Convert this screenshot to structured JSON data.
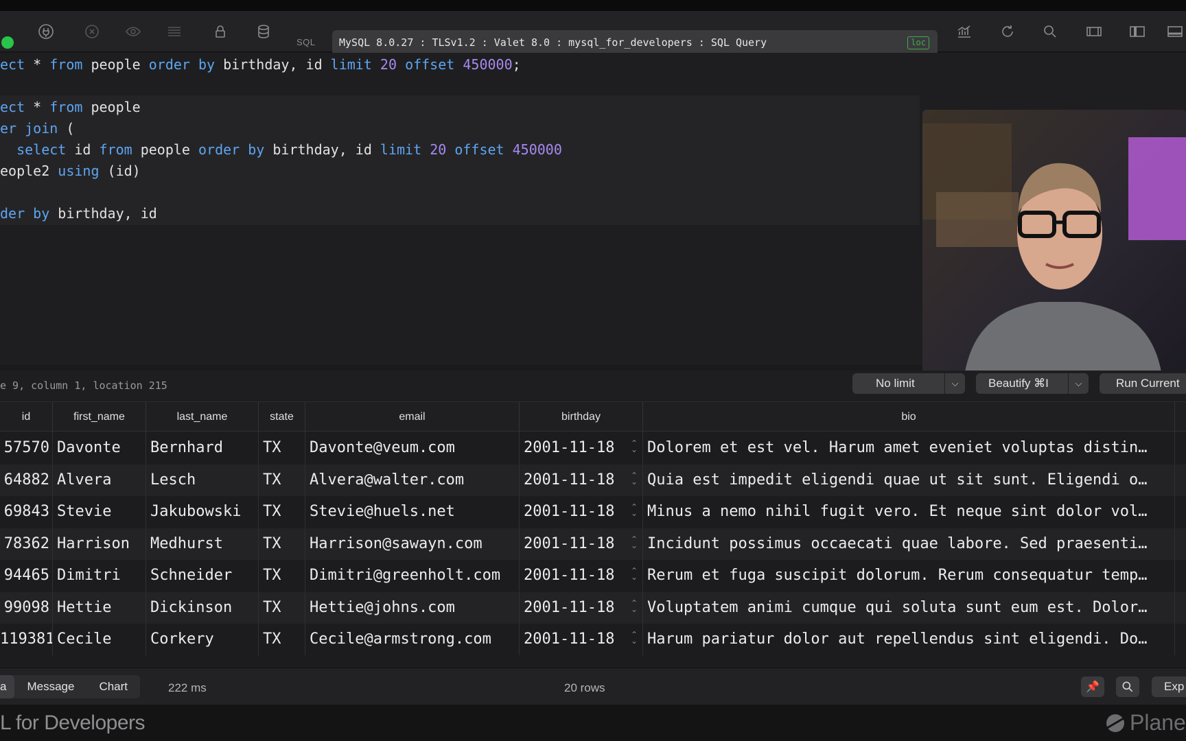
{
  "toolbar": {
    "sql_label": "SQL",
    "connection": "MySQL 8.0.27 : TLSv1.2 : Valet 8.0 : mysql_for_developers : SQL Query",
    "badge": "loc",
    "icons_left": [
      "connect-status",
      "plug-icon",
      "cancel-icon",
      "eye-icon",
      "list-icon",
      "lock-icon",
      "database-icon"
    ],
    "icons_right": [
      "activity-icon",
      "refresh-icon",
      "search-icon",
      "columns-icon",
      "sidebar-icon",
      "panel-icon"
    ]
  },
  "editor": {
    "lines": [
      [
        [
          "kw",
          "ect"
        ],
        [
          "plain",
          " * "
        ],
        [
          "kw",
          "from"
        ],
        [
          "plain",
          " people "
        ],
        [
          "kw",
          "order by"
        ],
        [
          "plain",
          " birthday, id "
        ],
        [
          "kw",
          "limit"
        ],
        [
          "plain",
          " "
        ],
        [
          "num",
          "20"
        ],
        [
          "plain",
          " "
        ],
        [
          "kw",
          "offset"
        ],
        [
          "plain",
          " "
        ],
        [
          "num",
          "450000"
        ],
        [
          "plain",
          ";"
        ]
      ],
      [],
      [
        [
          "kw",
          "ect"
        ],
        [
          "plain",
          " * "
        ],
        [
          "kw",
          "from"
        ],
        [
          "plain",
          " people"
        ]
      ],
      [
        [
          "kw",
          "er join"
        ],
        [
          "plain",
          " ("
        ]
      ],
      [
        [
          "plain",
          "  "
        ],
        [
          "kw",
          "select"
        ],
        [
          "plain",
          " id "
        ],
        [
          "kw",
          "from"
        ],
        [
          "plain",
          " people "
        ],
        [
          "kw",
          "order by"
        ],
        [
          "plain",
          " birthday, id "
        ],
        [
          "kw",
          "limit"
        ],
        [
          "plain",
          " "
        ],
        [
          "num",
          "20"
        ],
        [
          "plain",
          " "
        ],
        [
          "kw",
          "offset"
        ],
        [
          "plain",
          " "
        ],
        [
          "num",
          "450000"
        ]
      ],
      [
        [
          "plain",
          "eople2 "
        ],
        [
          "kw",
          "using"
        ],
        [
          "plain",
          " (id)"
        ]
      ],
      [],
      [
        [
          "kw",
          "der by"
        ],
        [
          "plain",
          " birthday, id"
        ]
      ]
    ],
    "cursor_info": "e 9, column 1, location 215",
    "limit_label": "No limit",
    "beautify_label": "Beautify ⌘I",
    "run_label": "Run Current"
  },
  "grid": {
    "columns": [
      "id",
      "first_name",
      "last_name",
      "state",
      "email",
      "birthday",
      "bio"
    ],
    "rows": [
      [
        "57570",
        "Davonte",
        "Bernhard",
        "TX",
        "Davonte@veum.com",
        "2001-11-18",
        "Dolorem et est vel. Harum amet eveniet voluptas distin…"
      ],
      [
        "64882",
        "Alvera",
        "Lesch",
        "TX",
        "Alvera@walter.com",
        "2001-11-18",
        "Quia est impedit eligendi quae ut sit sunt. Eligendi o…"
      ],
      [
        "69843",
        "Stevie",
        "Jakubowski",
        "TX",
        "Stevie@huels.net",
        "2001-11-18",
        "Minus a nemo nihil fugit vero. Et neque sint dolor vol…"
      ],
      [
        "78362",
        "Harrison",
        "Medhurst",
        "TX",
        "Harrison@sawayn.com",
        "2001-11-18",
        "Incidunt possimus occaecati quae labore. Sed praesenti…"
      ],
      [
        "94465",
        "Dimitri",
        "Schneider",
        "TX",
        "Dimitri@greenholt.com",
        "2001-11-18",
        "Rerum et fuga suscipit dolorum. Rerum consequatur temp…"
      ],
      [
        "99098",
        "Hettie",
        "Dickinson",
        "TX",
        "Hettie@johns.com",
        "2001-11-18",
        "Voluptatem animi cumque qui soluta sunt eum est. Dolor…"
      ],
      [
        "119381",
        "Cecile",
        "Corkery",
        "TX",
        "Cecile@armstrong.com",
        "2001-11-18",
        "Harum pariatur dolor aut repellendus sint eligendi. Do…"
      ]
    ]
  },
  "bottombar": {
    "tabs": [
      "a",
      "Message",
      "Chart"
    ],
    "timing": "222 ms",
    "row_count": "20 rows",
    "export_label": "Exp"
  },
  "footer": {
    "course_title": "L for Developers",
    "brand": "Planet"
  }
}
